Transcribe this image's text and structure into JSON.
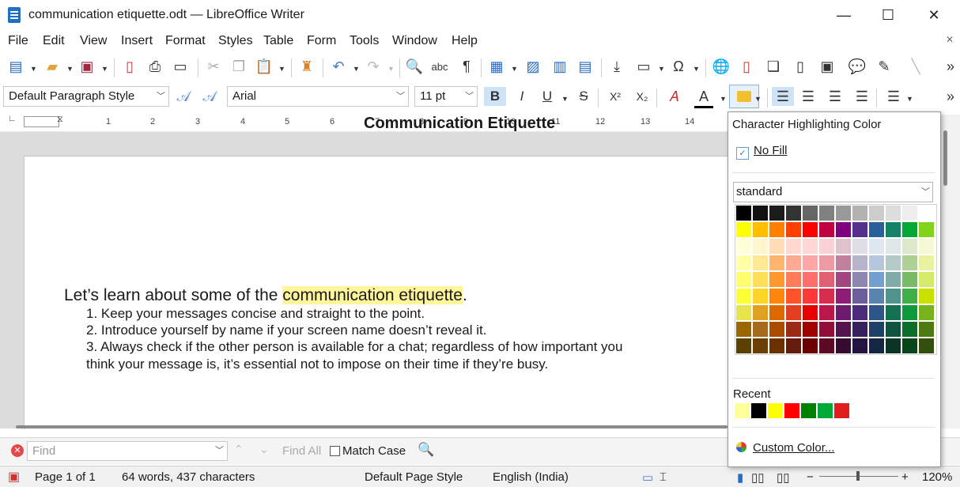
{
  "window": {
    "title": "communication etiquette.odt — LibreOffice Writer",
    "minimize": "—",
    "maximize": "☐",
    "close": "✕"
  },
  "menu": [
    "File",
    "Edit",
    "View",
    "Insert",
    "Format",
    "Styles",
    "Table",
    "Form",
    "Tools",
    "Window",
    "Help"
  ],
  "formatting": {
    "paragraph_style": "Default Paragraph Style",
    "font_name": "Arial",
    "font_size": "11 pt",
    "bold": "B",
    "italic": "I",
    "underline": "U",
    "strikethrough": "S",
    "superscript": "X²",
    "subscript": "X₂",
    "font_color_letter": "A"
  },
  "ruler": {
    "ticks": [
      "1",
      "2",
      "3",
      "4",
      "5",
      "6",
      "7",
      "8",
      "9",
      "10",
      "11",
      "12",
      "13",
      "14"
    ]
  },
  "document": {
    "title": "Communication Etiquette",
    "intro_before": "Let’s learn about some of the ",
    "intro_highlight": "communication etiquette",
    "intro_after": ".",
    "items": [
      "1. Keep your messages concise and straight to the point.",
      "2. Introduce yourself by name if your screen name doesn’t reveal it.",
      "3. Always check if the other person is available for a chat; regardless of how important you",
      "think your message is, it’s essential not to impose on their time if they’re busy."
    ]
  },
  "highlight_popup": {
    "title": "Character Highlighting Color",
    "no_fill": "No Fill",
    "palette": "standard",
    "recent_label": "Recent",
    "custom_color": "Custom Color...",
    "colors": [
      "#000000",
      "#111111",
      "#1c1c1c",
      "#333333",
      "#666666",
      "#808080",
      "#999999",
      "#b2b2b2",
      "#cccccc",
      "#dddddd",
      "#eeeeee",
      "#ffffff",
      "#ffff00",
      "#ffbf00",
      "#ff8000",
      "#ff4000",
      "#ff0000",
      "#bf0041",
      "#800080",
      "#55308d",
      "#2a6099",
      "#158466",
      "#00a933",
      "#81d41a",
      "#ffffd7",
      "#fff5ce",
      "#ffdbb6",
      "#ffd8ce",
      "#ffd7d7",
      "#f7d1d5",
      "#e0c2cd",
      "#dedce6",
      "#dee6ef",
      "#dee7e5",
      "#dde8cb",
      "#f6f9d4",
      "#ffffa6",
      "#ffe994",
      "#ffb66c",
      "#ffaa95",
      "#ffa6a6",
      "#ec9ba4",
      "#bf819e",
      "#b7b3ca",
      "#b4c7dc",
      "#b3cac7",
      "#afd095",
      "#e8f2a1",
      "#ffff6d",
      "#ffde59",
      "#ff972f",
      "#ff7b59",
      "#ff6d6d",
      "#e16173",
      "#a1467e",
      "#8e86ae",
      "#729fcf",
      "#81aca6",
      "#77bc65",
      "#d4ea6b",
      "#ffff38",
      "#ffd428",
      "#ff860d",
      "#ff5429",
      "#ff3838",
      "#d62e4e",
      "#8d1d75",
      "#6b5e9b",
      "#5983b0",
      "#50938a",
      "#3faf46",
      "#c9e000",
      "#e6e64c",
      "#e0a020",
      "#dd6a00",
      "#e13f1f",
      "#e60000",
      "#b8194a",
      "#6e1a6e",
      "#4b2c7a",
      "#2e5588",
      "#147050",
      "#0e9a3c",
      "#77b31a",
      "#996600",
      "#a56a1a",
      "#a84c00",
      "#9c2b14",
      "#a00000",
      "#8f0f38",
      "#54124f",
      "#37205e",
      "#1e3f66",
      "#0f533e",
      "#0b6d2a",
      "#4e7a14",
      "#5c4000",
      "#6b3f00",
      "#6b3200",
      "#641d0c",
      "#6b0000",
      "#5c0a24",
      "#350b32",
      "#231540",
      "#132744",
      "#0a3526",
      "#06461a",
      "#344f0d"
    ],
    "recent": [
      "#ffff99",
      "#000000",
      "#ffff00",
      "#ff0000",
      "#008000",
      "#00a933",
      "#e11d1d"
    ]
  },
  "find": {
    "placeholder": "Find",
    "find_all": "Find All",
    "match_case": "Match Case"
  },
  "status": {
    "page": "Page 1 of 1",
    "words": "64 words, 437 characters",
    "page_style": "Default Page Style",
    "language": "English (India)",
    "zoom": "120%"
  }
}
